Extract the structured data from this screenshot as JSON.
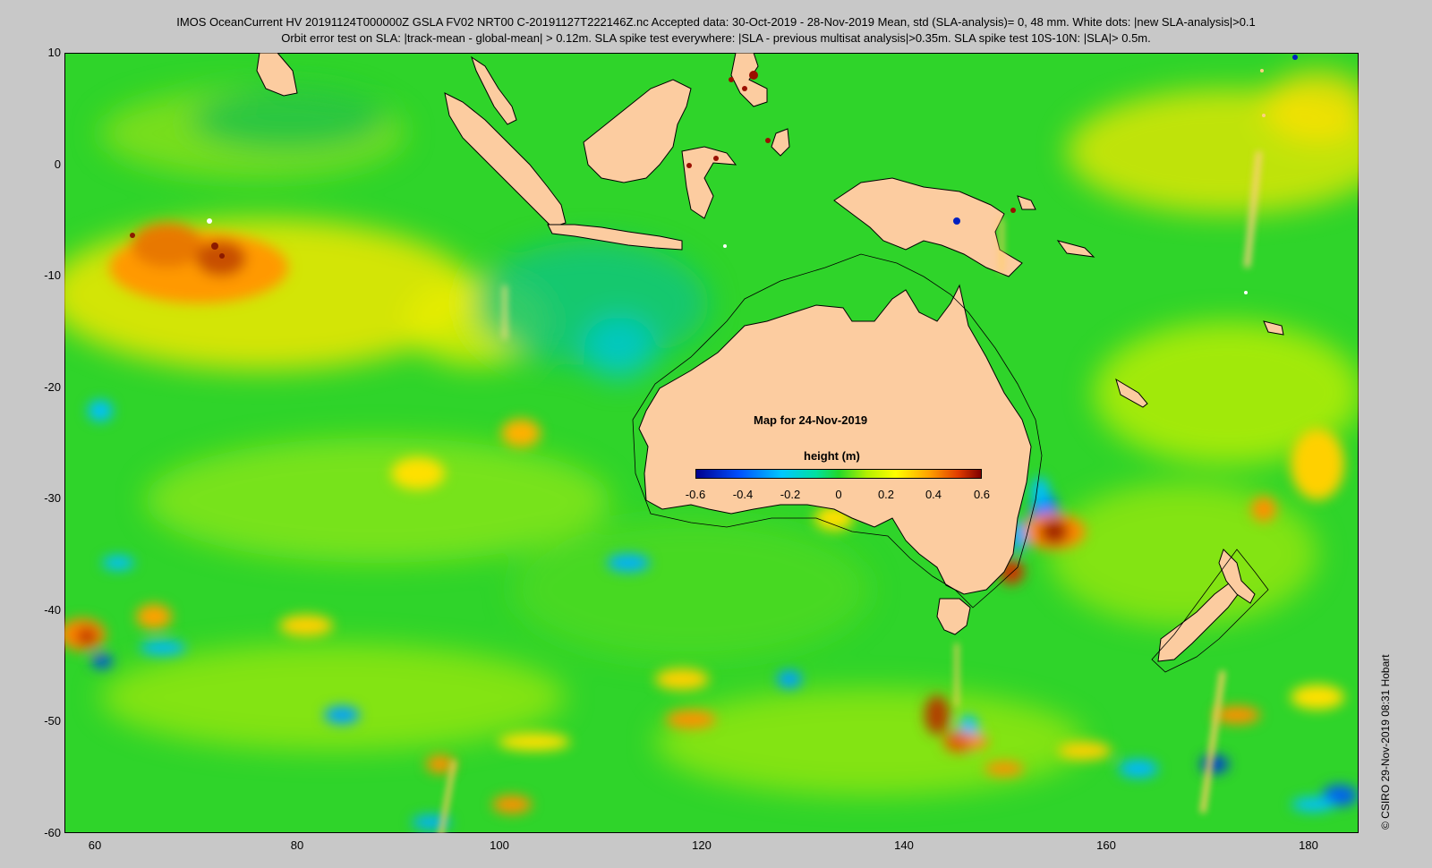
{
  "header": {
    "line1": "IMOS OceanCurrent HV 20191124T000000Z GSLA FV02 NRT00 C-20191127T222146Z.nc  Accepted data: 30-Oct-2019 - 28-Nov-2019 Mean, std (SLA-analysis)= 0, 48 mm. White dots: |new SLA-analysis|>0.1",
    "line2": "Orbit error test on SLA: |track-mean  - global-mean| > 0.12m.  SLA spike test everywhere: |SLA - previous multisat analysis|>0.35m. SLA spike test 10S-10N: |SLA|> 0.5m."
  },
  "map": {
    "lon_range": [
      57,
      185
    ],
    "lat_range": [
      -60,
      10
    ],
    "lon_ticks": [
      "60",
      "80",
      "100",
      "120",
      "140",
      "160",
      "180"
    ],
    "lat_ticks": [
      "10",
      "0",
      "-10",
      "-20",
      "-30",
      "-40",
      "-50",
      "-60"
    ],
    "date_label": "Map for 24-Nov-2019",
    "colors": {
      "ocean_base": "#2fd42a",
      "land": "#fccca0",
      "coast": "#000000"
    }
  },
  "colorbar": {
    "label": "height (m)",
    "range": [
      -0.6,
      0.6
    ],
    "ticks": [
      "-0.6",
      "-0.4",
      "-0.2",
      "0",
      "0.2",
      "0.4",
      "0.6"
    ]
  },
  "credit": "© CSIRO 29-Nov-2019 08:31 Hobart"
}
